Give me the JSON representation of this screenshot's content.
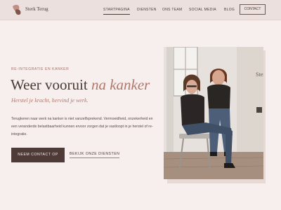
{
  "header": {
    "brand": "Sterk Terug",
    "nav": [
      {
        "label": "STARTPAGINA",
        "active": true
      },
      {
        "label": "DIENSTEN"
      },
      {
        "label": "ONS TEAM"
      },
      {
        "label": "SOCIAL MEDIA"
      },
      {
        "label": "BLOG"
      }
    ],
    "contact_label": "CONTACT"
  },
  "hero": {
    "eyebrow": "RE-INTEGRATIE EN KANKER",
    "title_main": "Weer vooruit ",
    "title_accent": "na kanker",
    "subtitle": "Herstel je kracht, hervind je werk.",
    "body": "Terugkeren naar werk na kanker is niet vanzelfsprekend. Vermoeidheid, onzekerheid en een veranderde belastbaarheid kunnen ervoor zorgen dat je vastloopt in je herstel of re-integratie.",
    "cta_label": "NEEM CONTACT OP",
    "secondary_label": "BEKIJK ONZE DIENSTEN"
  },
  "photo": {
    "wall_sign": "Sterk Terug"
  },
  "colors": {
    "background": "#f7efee",
    "header": "#ebe0dd",
    "accent": "#b0776a",
    "button": "#4e3b38"
  }
}
